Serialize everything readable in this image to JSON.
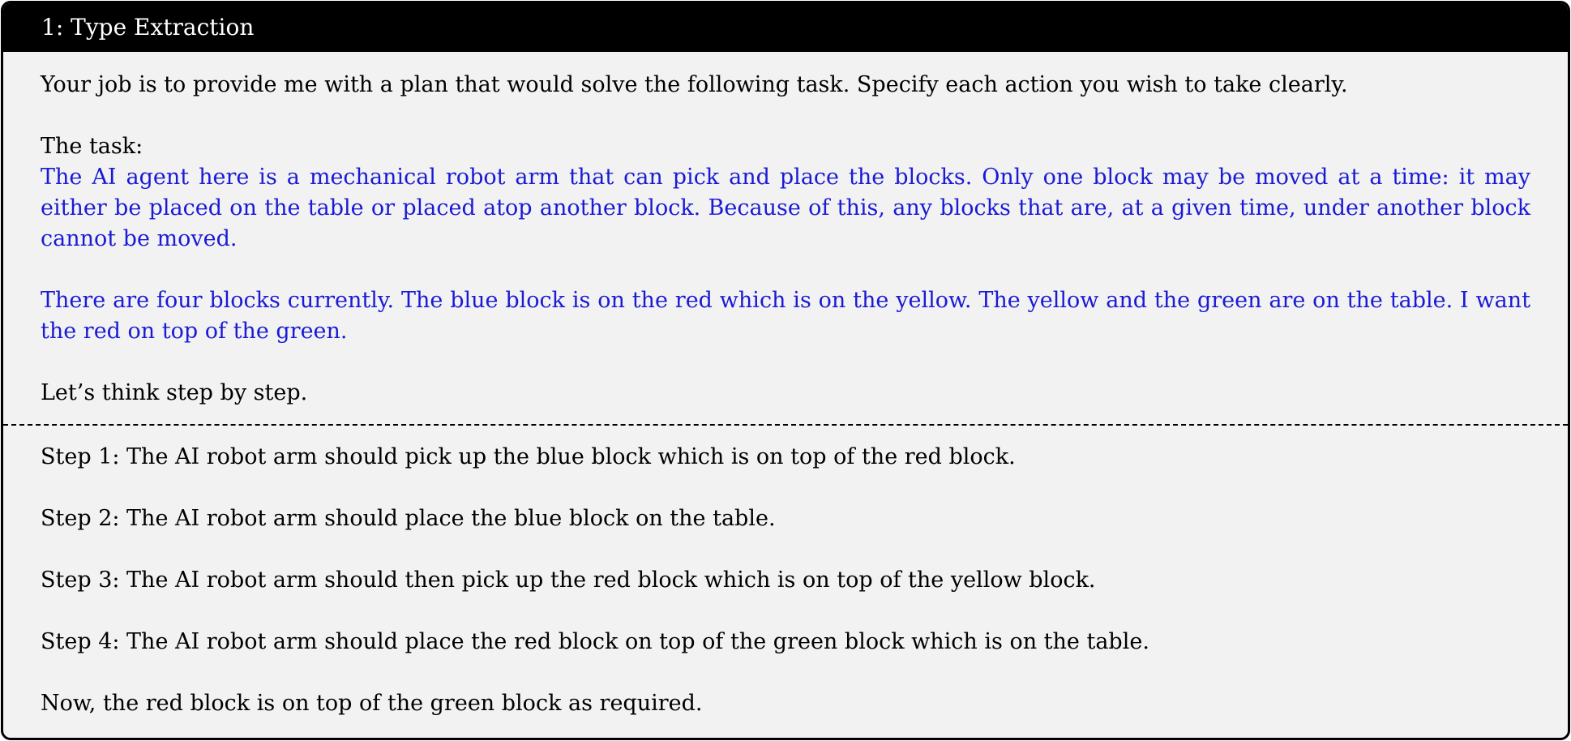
{
  "header": {
    "title": "1:  Type Extraction"
  },
  "prompt": {
    "instruction": "Your job is to provide me with a plan that would solve the following task. Specify each action you wish to take clearly.",
    "task_label": "The task:",
    "task_description": "The AI agent here is a mechanical robot arm that can pick and place the blocks. Only one block may be moved at a time: it may either be placed on the table or placed atop another block. Because of this, any blocks that are, at a given time, under another block cannot be moved.",
    "task_scenario": "There are four blocks currently.  The blue block is on the red which is on the yellow.  The yellow and the green are on the table. I want the red on top of the green.",
    "closing": "Let’s think step by step."
  },
  "response": {
    "steps": [
      "Step 1: The AI robot arm should pick up the blue block which is on top of the red block.",
      "Step 2: The AI robot arm should place the blue block on the table.",
      "Step 3: The AI robot arm should then pick up the red block which is on top of the yellow block.",
      "Step 4: The AI robot arm should place the red block on top of the green block which is on the table."
    ],
    "conclusion": "Now, the red block is on top of the green block as required."
  },
  "colors": {
    "header_bg": "#000000",
    "panel_bg": "#f2f2f2",
    "task_text": "#1a1ad6"
  }
}
